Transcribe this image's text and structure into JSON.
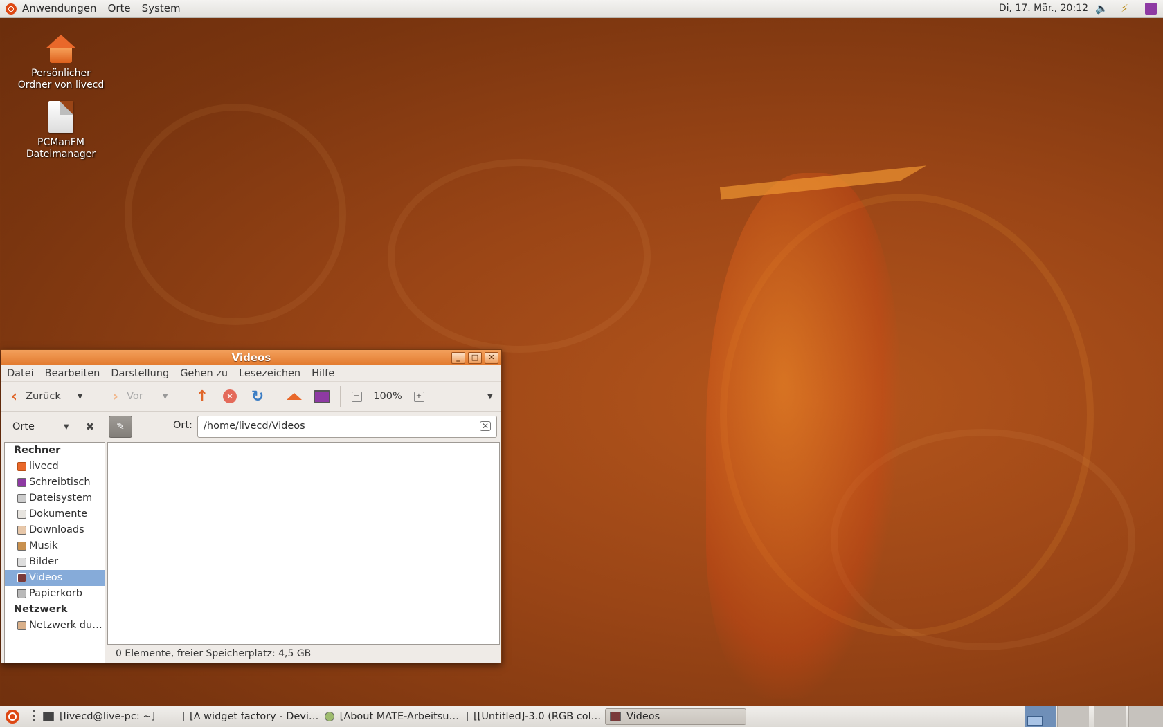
{
  "top_panel": {
    "menus": [
      "Anwendungen",
      "Orte",
      "System"
    ],
    "clock": "Di, 17. Mär., 20:12"
  },
  "desktop": {
    "icons": [
      {
        "label_line1": "Persönlicher",
        "label_line2": "Ordner von livecd",
        "icon": "home-folder-icon"
      },
      {
        "label_line1": "PCManFM",
        "label_line2": "Dateimanager",
        "icon": "file-icon"
      }
    ]
  },
  "window": {
    "title": "Videos",
    "menu": [
      "Datei",
      "Bearbeiten",
      "Darstellung",
      "Gehen zu",
      "Lesezeichen",
      "Hilfe"
    ],
    "toolbar": {
      "back": "Zurück",
      "forward": "Vor",
      "zoom": "100%"
    },
    "sidebar_selector": "Orte",
    "location_label": "Ort:",
    "location_value": "/home/livecd/Videos",
    "sidebar": {
      "section1": "Rechner",
      "items1": [
        "livecd",
        "Schreibtisch",
        "Dateisystem",
        "Dokumente",
        "Downloads",
        "Musik",
        "Bilder",
        "Videos",
        "Papierkorb"
      ],
      "section2": "Netzwerk",
      "items2": [
        "Netzwerk du…"
      ]
    },
    "status": "0 Elemente, freier Speicherplatz: 4,5 GB"
  },
  "taskbar": {
    "tasks": [
      "[livecd@live-pc: ~]",
      "[A widget factory - Devi…",
      "[About MATE-Arbeitsu…",
      "[[Untitled]-3.0 (RGB col…",
      "Videos"
    ]
  },
  "colors": {
    "accent": "#e27a2e",
    "selection": "#86abd9",
    "desktop": "#9a4516"
  }
}
